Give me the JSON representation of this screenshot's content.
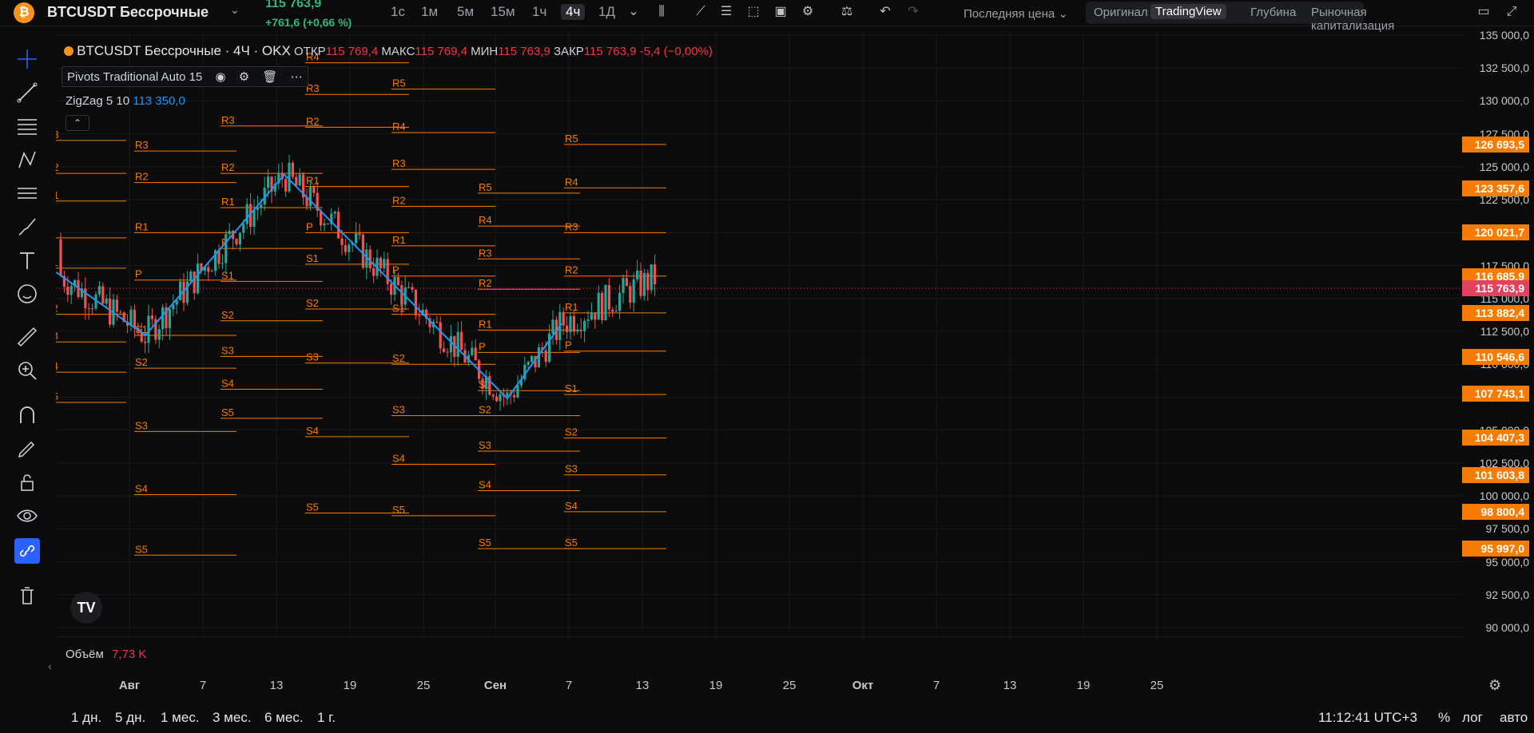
{
  "header": {
    "coin_icon": "₿",
    "symbol": "BTCUSDT Бессрочные",
    "last_price": "115 763,9",
    "change": "+761,6 (+0,66 %)",
    "timeframes": [
      "1с",
      "1м",
      "5м",
      "15м",
      "1ч",
      "4ч",
      "1Д"
    ],
    "active_timeframe": "4ч",
    "price_source": "Последняя цена",
    "views": [
      "Оригинал",
      "TradingView",
      "Глубина",
      "Рыночная капитализация"
    ],
    "active_view": "TradingView"
  },
  "legend": {
    "title": "BTCUSDT Бессрочные · 4Ч · OKX",
    "open_label": "ОТКР",
    "open": "115 769,4",
    "high_label": "МАКС",
    "high": "115 769,4",
    "low_label": "МИН",
    "low": "115 763,9",
    "close_label": "ЗАКР",
    "close": "115 763,9",
    "change": "-5,4 (−0,00%)",
    "indicator1": "Pivots Traditional Auto 15",
    "indicator2_name": "ZigZag 5 10",
    "indicator2_value": "113 350,0",
    "volume_label": "Объём",
    "volume_value": "7,73 K"
  },
  "price_axis": {
    "labels": [
      "135 000,0",
      "132 500,0",
      "130 000,0",
      "127 500,0",
      "125 000,0",
      "122 500,0",
      "117 500,0",
      "115 000,0",
      "112 500,0",
      "110 000,0",
      "105 000,0",
      "102 500,0",
      "100 000,0",
      "97 500,0",
      "95 000,0",
      "92 500,0",
      "90 000,0"
    ],
    "tags": [
      "126 693,5",
      "123 357,6",
      "120 021,7",
      "116 685,9",
      "115 763,9",
      "113 882,4",
      "110 546,6",
      "107 743,1",
      "104 407,3",
      "101 603,8",
      "98 800,4",
      "95 997,0"
    ],
    "current_tag": "115 763,9"
  },
  "time_axis": {
    "labels": [
      "Авг",
      "7",
      "13",
      "19",
      "25",
      "Сен",
      "7",
      "13",
      "19",
      "25",
      "Окт",
      "7",
      "13",
      "19",
      "25"
    ]
  },
  "bottom": {
    "ranges": [
      "1 дн.",
      "5 дн.",
      "1 мес.",
      "3 мес.",
      "6 мес.",
      "1 г."
    ],
    "clock": "11:12:41 UTC+3",
    "percent": "%",
    "log": "лог",
    "auto": "авто"
  },
  "pivot_levels": [
    {
      "label": "R3",
      "price": 127000,
      "x0": 0,
      "x1": 0.072
    },
    {
      "label": "R2",
      "price": 124500,
      "x0": 0,
      "x1": 0.072
    },
    {
      "label": "R1",
      "price": 122400,
      "x0": 0,
      "x1": 0.072
    },
    {
      "label": "P",
      "price": 119600,
      "x0": 0,
      "x1": 0.072
    },
    {
      "label": "S1",
      "price": 117300,
      "x0": 0,
      "x1": 0.072
    },
    {
      "label": "S2",
      "price": 113800,
      "x0": 0,
      "x1": 0.072
    },
    {
      "label": "S3",
      "price": 111700,
      "x0": 0,
      "x1": 0.072
    },
    {
      "label": "S4",
      "price": 109400,
      "x0": 0,
      "x1": 0.072
    },
    {
      "label": "S5",
      "price": 107100,
      "x0": 0,
      "x1": 0.072
    }
  ],
  "chart_data": {
    "type": "candlestick",
    "pivot_color": "#f57c00",
    "zigzag_color": "#2196f3",
    "up_color": "#26a69a",
    "down_color": "#ef5350",
    "zigzag_points": [
      {
        "t": "Jul 27",
        "p": 117000
      },
      {
        "t": "Aug 2",
        "p": 112200
      },
      {
        "t": "Aug 13",
        "p": 124400
      },
      {
        "t": "Sep 1",
        "p": 107400
      },
      {
        "t": "Sep 5",
        "p": 113100
      }
    ]
  }
}
